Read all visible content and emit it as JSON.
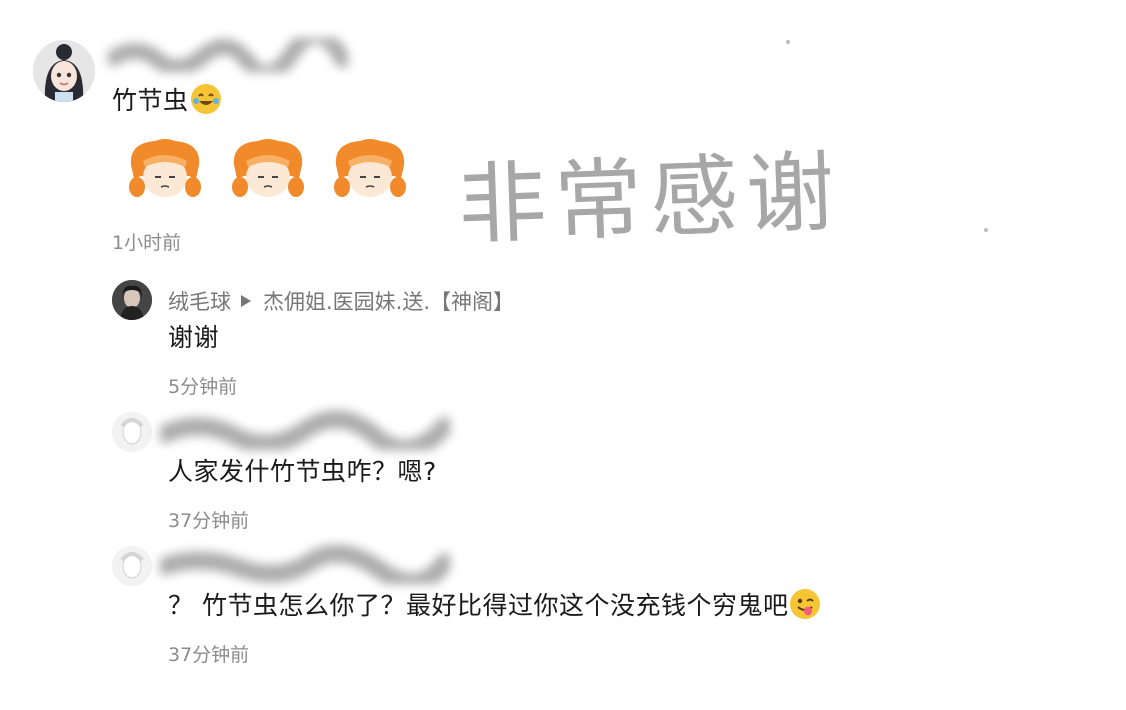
{
  "comment": {
    "text": "竹节虫",
    "time": "1小时前"
  },
  "watermark": "非常感谢",
  "replies": [
    {
      "user": "绒毛球",
      "reply_to": "杰佣姐.医园妹.送.【神阁】",
      "text": "谢谢",
      "time": "5分钟前"
    },
    {
      "text": "人家发什竹节虫咋？嗯?",
      "time": "37分钟前"
    },
    {
      "text": "？ 竹节虫怎么你了？最好比得过你这个没充钱个穷鬼吧",
      "time": "37分钟前"
    }
  ],
  "icons": {
    "laugh_emoji": "rolling-on-floor-laughing",
    "tongue_emoji": "winking-face-with-tongue",
    "sticker": "orange-hair-chibi-sticker",
    "reply_arrow": "triangle-right"
  },
  "colors": {
    "time_gray": "#8c8c8c",
    "sticker_orange": "#f08a2a",
    "emoji_yellow": "#f6c535"
  }
}
